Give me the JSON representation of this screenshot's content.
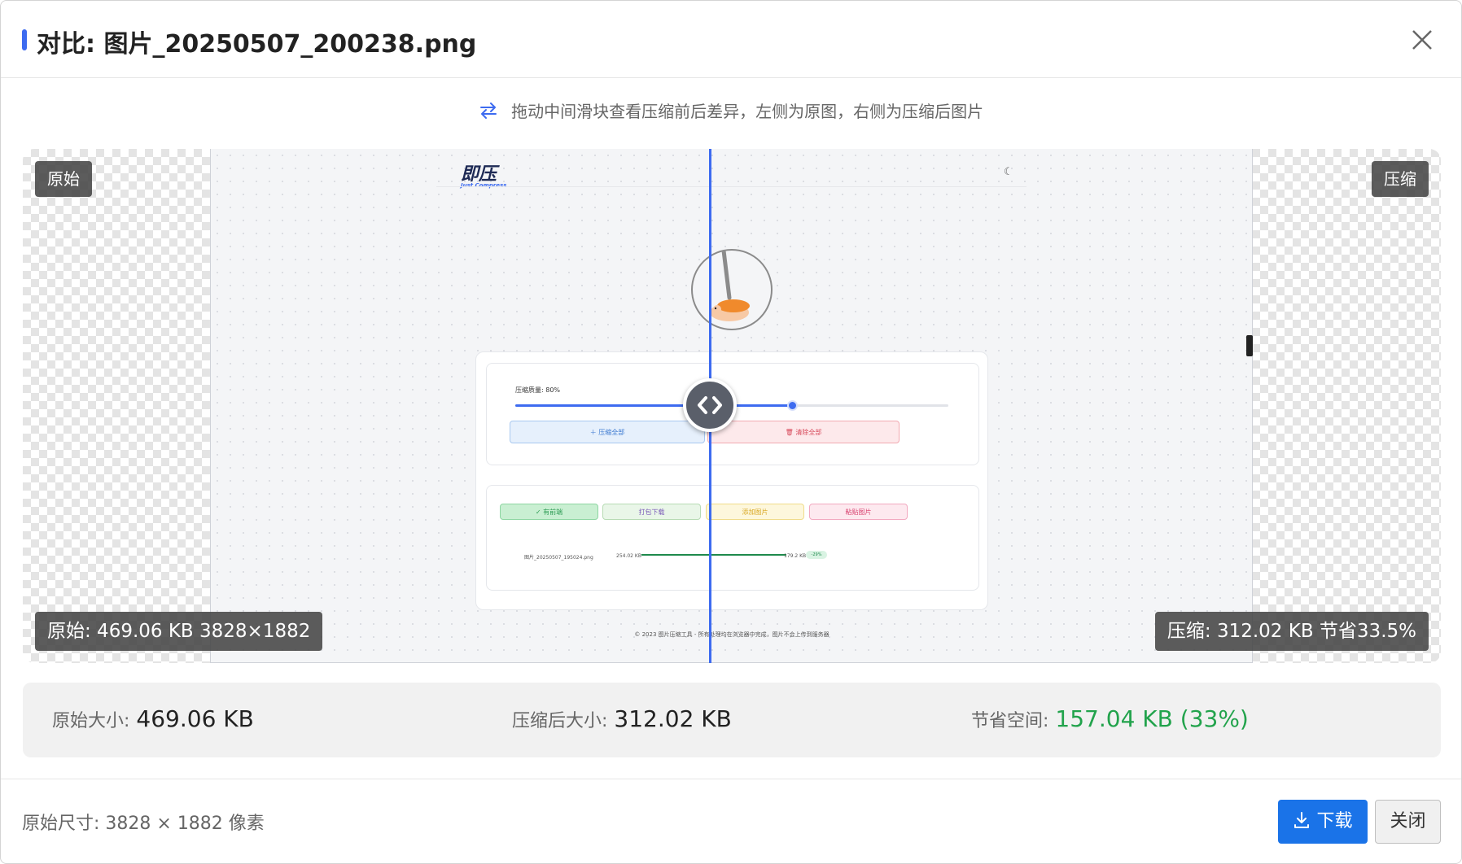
{
  "dialog": {
    "title": "对比: 图片_20250507_200238.png",
    "hint": "拖动中间滑块查看压缩前后差异，左侧为原图，右侧为压缩后图片"
  },
  "compare": {
    "label_original": "原始",
    "label_compressed": "压缩",
    "info_original": "原始: 469.06 KB 3828×1882",
    "info_compressed": "压缩: 312.02 KB 节省33.5%",
    "divider_position_pct": 42
  },
  "preview_app": {
    "logo": "即压",
    "logo_sub": "Just Compress",
    "quality_label": "压缩质量: 80%",
    "quality_value_pct": 80,
    "btn_compress_all": "＋ 压缩全部",
    "btn_clear_all": "🗑 清除全部",
    "btn_done": "✓ 有前端",
    "btn_pack": "打包下载",
    "btn_add": "添加图片",
    "btn_paste": "粘贴图片",
    "row_name": "图片_20250507_195024.png",
    "row_orig": "254.02 KB",
    "row_new": "179.2 KB",
    "row_pct": "-29%",
    "footer": "© 2023 图片压缩工具 - 所有处理均在浏览器中完成，图片不会上传到服务器"
  },
  "stats": {
    "original_label": "原始大小:",
    "original_value": "469.06 KB",
    "compressed_label": "压缩后大小:",
    "compressed_value": "312.02 KB",
    "saved_label": "节省空间:",
    "saved_value": "157.04 KB (33%)"
  },
  "footer": {
    "dimensions": "原始尺寸: 3828 × 1882 像素",
    "download_label": "下载",
    "close_label": "关闭"
  },
  "colors": {
    "accent": "#3d6bf0",
    "download_bg": "#1a73e8",
    "saved_green": "#22a34c"
  },
  "icons": [
    "close-icon",
    "swap-icon",
    "moon-icon",
    "download-icon",
    "drag-handle-icon"
  ]
}
